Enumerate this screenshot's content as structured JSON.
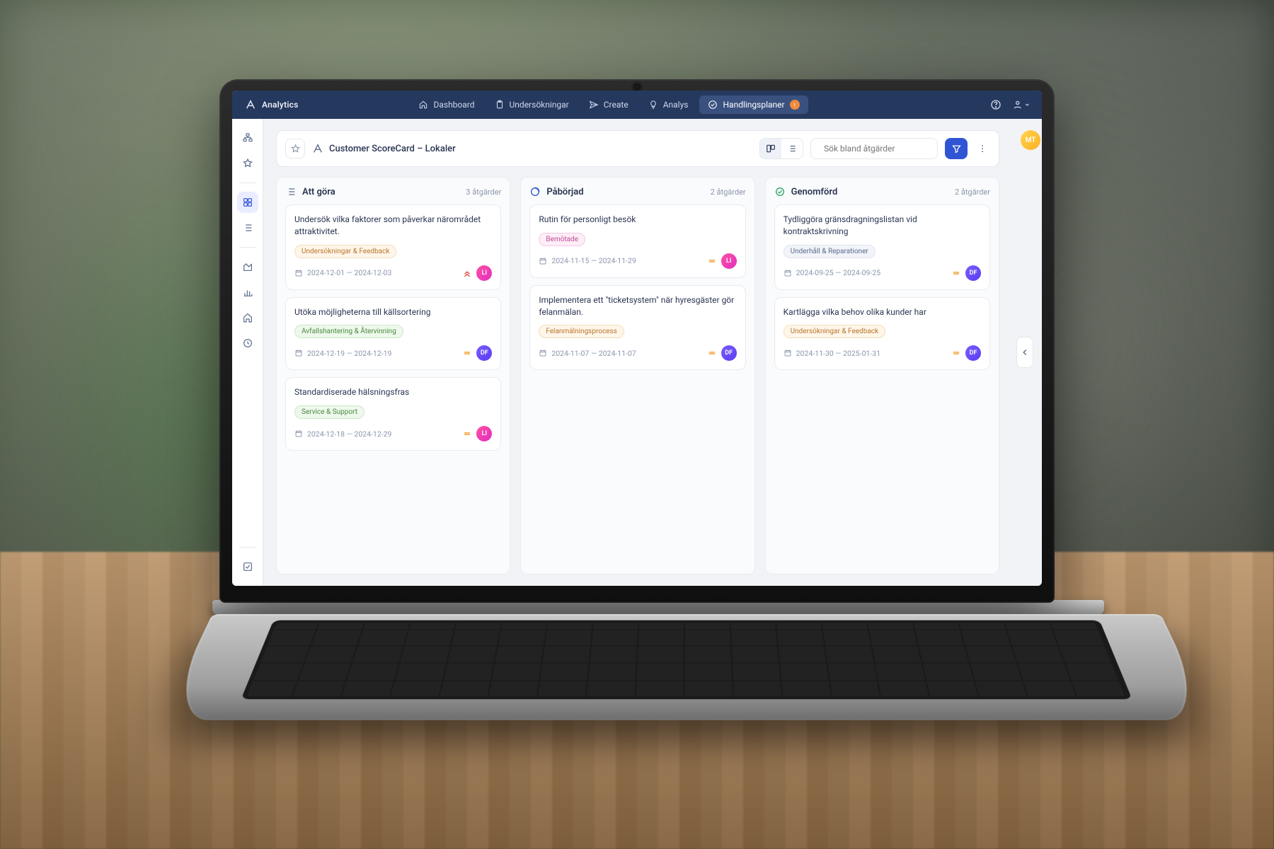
{
  "brand": "Analytics",
  "nav": [
    {
      "icon": "home",
      "label": "Dashboard"
    },
    {
      "icon": "clipboard",
      "label": "Undersökningar"
    },
    {
      "icon": "send",
      "label": "Create"
    },
    {
      "icon": "bulb",
      "label": "Analys"
    },
    {
      "icon": "checklist",
      "label": "Handlingsplaner",
      "active": true,
      "badge": true
    }
  ],
  "user_initials": "MT",
  "page": {
    "title": "Customer ScoreCard – Lokaler",
    "search_placeholder": "Sök bland åtgärder"
  },
  "columns": [
    {
      "id": "todo",
      "icon": "list",
      "title": "Att göra",
      "count_label": "3 åtgärder",
      "icon_color": "#5a6b8c",
      "cards": [
        {
          "title": "Undersök vilka faktorer som påverkar närområdet attraktivitet.",
          "tag": {
            "text": "Undersökningar & Feedback",
            "fg": "#b8762b",
            "bg": "#fff6ea",
            "bd": "#f3dfb9"
          },
          "dates": "2024-12-01 — 2024-12-03",
          "priority": "highest",
          "assignee": "LI"
        },
        {
          "title": "Utöka möjligheterna till källsortering",
          "tag": {
            "text": "Avfallshantering & Återvinning",
            "fg": "#4a8a3f",
            "bg": "#eef8ec",
            "bd": "#cde8c6"
          },
          "dates": "2024-12-19 — 2024-12-19",
          "priority": "medium",
          "assignee": "DF"
        },
        {
          "title": "Standardiserade hälsningsfras",
          "tag": {
            "text": "Service & Support",
            "fg": "#4a8a3f",
            "bg": "#eef8ec",
            "bd": "#cde8c6"
          },
          "dates": "2024-12-18 — 2024-12-29",
          "priority": "medium",
          "assignee": "LI"
        }
      ]
    },
    {
      "id": "inprogress",
      "icon": "progress",
      "title": "Påbörjad",
      "count_label": "2 åtgärder",
      "icon_color": "#2f55d4",
      "cards": [
        {
          "title": "Rutin för personligt besök",
          "tag": {
            "text": "Bemötade",
            "fg": "#c24a9a",
            "bg": "#fdeef7",
            "bd": "#f5c9e5"
          },
          "dates": "2024-11-15 — 2024-11-29",
          "priority": "medium",
          "assignee": "LI"
        },
        {
          "title": "Implementera ett \"ticketsystem\" när hyresgäster gör felanmälan.",
          "tag": {
            "text": "Felanmälningsprocess",
            "fg": "#b8762b",
            "bg": "#fff6ea",
            "bd": "#f3dfb9"
          },
          "dates": "2024-11-07 — 2024-11-07",
          "priority": "medium",
          "assignee": "DF"
        }
      ]
    },
    {
      "id": "done",
      "icon": "check",
      "title": "Genomförd",
      "count_label": "2 åtgärder",
      "icon_color": "#2fa36b",
      "cards": [
        {
          "title": "Tydliggöra gränsdragningslistan vid kontraktskrivning",
          "tag": {
            "text": "Underhåll & Reparationer",
            "fg": "#5a6b8c",
            "bg": "#f2f4f9",
            "bd": "#dfe4ef"
          },
          "dates": "2024-09-25 — 2024-09-25",
          "priority": "medium",
          "assignee": "DF"
        },
        {
          "title": "Kartlägga vilka behov olika kunder har",
          "tag": {
            "text": "Undersökningar & Feedback",
            "fg": "#b8762b",
            "bg": "#fff6ea",
            "bd": "#f3dfb9"
          },
          "dates": "2024-11-30 — 2025-01-31",
          "priority": "medium",
          "assignee": "DF"
        }
      ]
    }
  ]
}
